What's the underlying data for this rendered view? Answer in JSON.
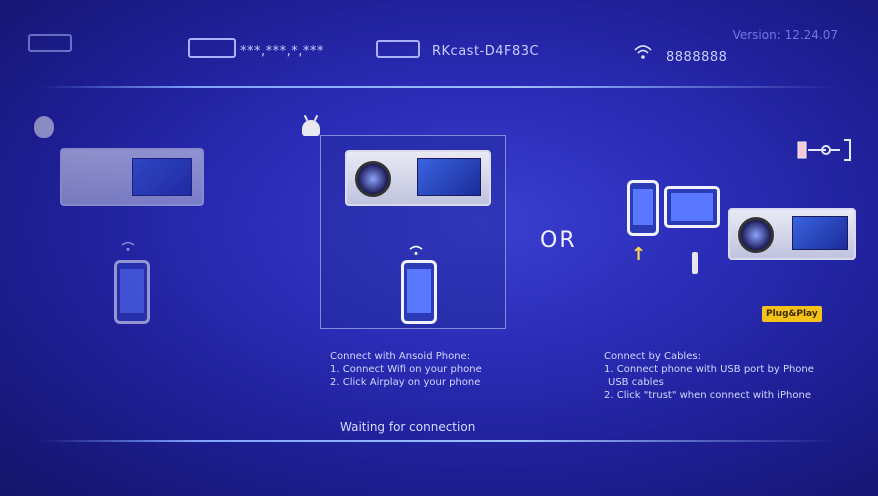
{
  "header": {
    "password_mask": "***,***,*,***",
    "device_name": "RKcast-D4F83C",
    "wifi_password": "8888888",
    "version": "Version: 12.24.07"
  },
  "left_section": {
    "instructions": [
      "",
      "",
      "",
      ""
    ]
  },
  "android_section": {
    "title": "Connect with Ansoid Phone:",
    "step1": "1. Connect Wifi on your phone",
    "step2": "2. Click Airplay on your phone"
  },
  "or_label": "OR",
  "cable_section": {
    "title": "Connect by Cables:",
    "step1": "1. Connect phone with USB port by Phone",
    "step1b": "USB cables",
    "step2": "2. Click \"trust\" when connect with iPhone",
    "badge": "Plug&Play"
  },
  "status": {
    "waiting": "Waiting for connection"
  },
  "icons": {
    "wifi": "wifi-icon",
    "android": "android-icon",
    "apple": "apple-icon",
    "cable": "cable-icon"
  },
  "colors": {
    "accent_line": "#9fc0ff",
    "badge": "#f5c21a",
    "background": "#2a2cb6"
  }
}
